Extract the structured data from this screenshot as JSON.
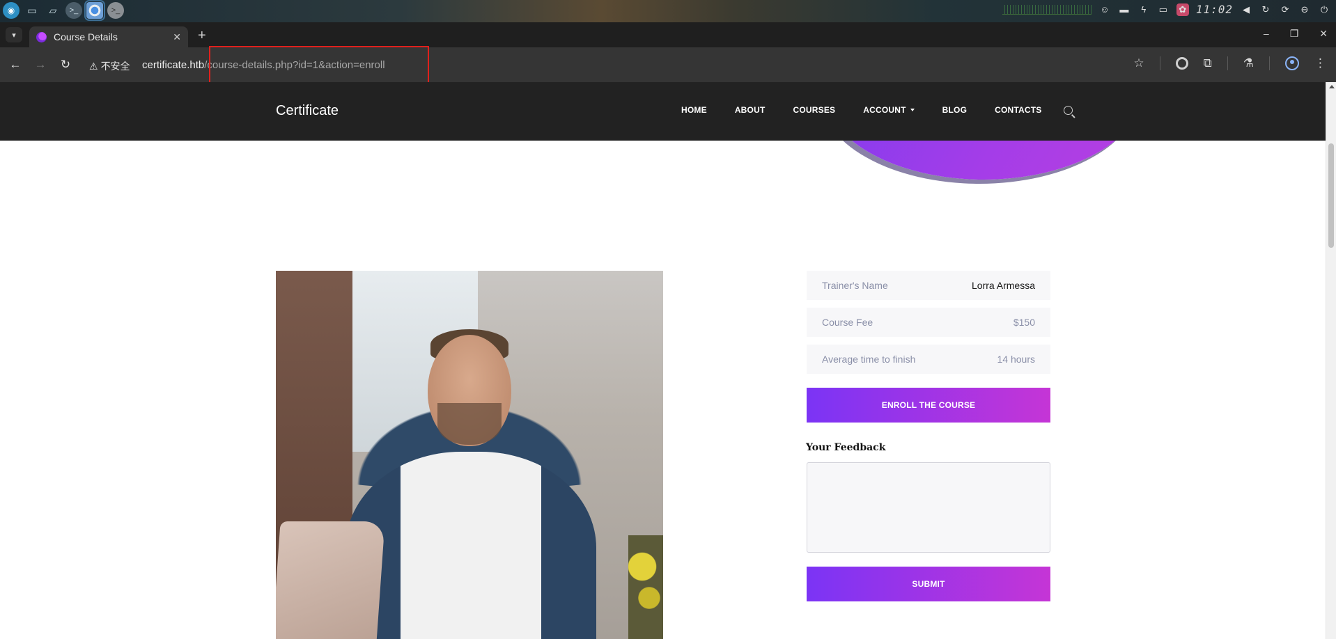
{
  "os": {
    "clock": "11:02",
    "taskbar_icons": [
      "app-launcher-icon",
      "desktop-icon",
      "folder-icon",
      "terminal-icon",
      "chrome-icon",
      "terminal-icon"
    ],
    "tray_icons": [
      "user-icon",
      "keyboard-icon",
      "battery-icon",
      "display-icon",
      "network-icon",
      "volume-icon",
      "refresh-icon",
      "sync-icon",
      "stop-icon",
      "power-icon"
    ]
  },
  "browser": {
    "tab_title": "Course Details",
    "new_tab_symbol": "+",
    "security_label": "不安全",
    "url_host": "certificate.htb",
    "url_path": "/course-details.php?id=1&action=enroll",
    "highlight_color": "#e0201c"
  },
  "site": {
    "logo": "Certificate",
    "nav": [
      {
        "label": "HOME"
      },
      {
        "label": "ABOUT"
      },
      {
        "label": "COURSES"
      },
      {
        "label": "ACCOUNT"
      },
      {
        "label": "BLOG"
      },
      {
        "label": "CONTACTS"
      }
    ]
  },
  "course": {
    "info": [
      {
        "label": "Trainer's Name",
        "value": "Lorra Armessa"
      },
      {
        "label": "Course Fee",
        "value": "$150"
      },
      {
        "label": "Average time to finish",
        "value": "14 hours"
      }
    ],
    "enroll_button": "ENROLL THE COURSE",
    "feedback_title": "Your Feedback",
    "feedback_value": "",
    "submit_button": "SUBMIT",
    "accent_gradient": [
      "#7b34f5",
      "#c535d6"
    ]
  }
}
